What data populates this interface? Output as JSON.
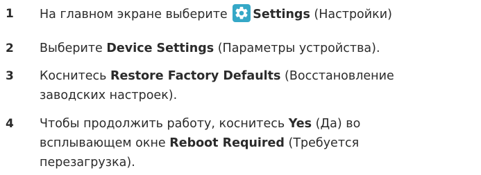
{
  "accent_color": "#35a8c7",
  "steps": [
    {
      "number": "1",
      "before": "На главном экране выберите ",
      "icon": "settings-gear-icon",
      "bold": "Settings",
      "after": " (Настройки)"
    },
    {
      "number": "2",
      "before": "Выберите ",
      "bold": "Device Settings",
      "after": " (Параметры устройства)."
    },
    {
      "number": "3",
      "before": "Коснитесь ",
      "bold": "Restore Factory Defaults",
      "after": " (Восстановление",
      "line2": "заводских настроек)."
    },
    {
      "number": "4",
      "before": "Чтобы продолжить работу, коснитесь ",
      "bold": "Yes",
      "after": " (Да) во",
      "line2_before": "всплывающем окне ",
      "line2_bold": "Reboot Required",
      "line2_after": " (Требуется",
      "line3": "перезагрузка)."
    }
  ]
}
